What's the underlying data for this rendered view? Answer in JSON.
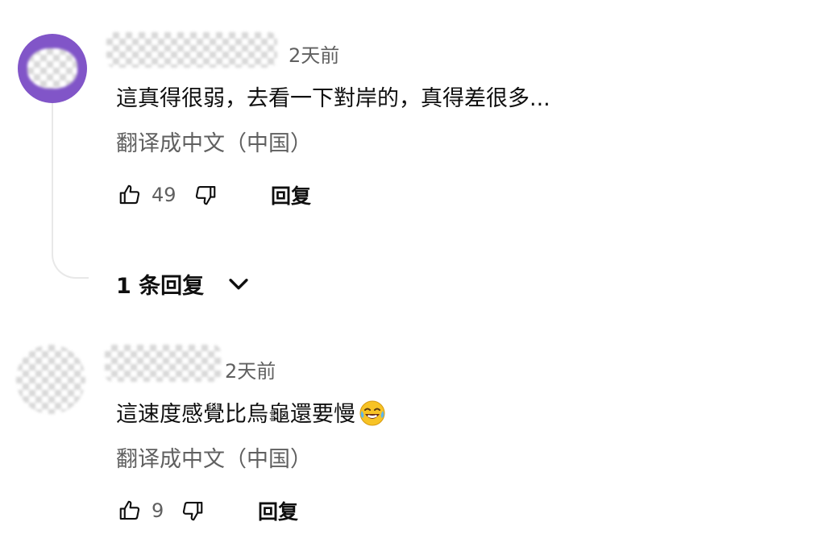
{
  "comments": [
    {
      "time": "2天前",
      "text": "這真得很弱，去看一下對岸的，真得差很多...",
      "translate": "翻译成中文（中国）",
      "likes": "49",
      "reply": "回复",
      "replies_toggle": "1 条回复",
      "avatar_color": "#8155c8"
    },
    {
      "time": "2天前",
      "text": "這速度感覺比烏龜還要慢",
      "emoji": "face-with-tears-of-joy",
      "translate": "翻译成中文（中国）",
      "likes": "9",
      "reply": "回复"
    }
  ],
  "icons": {
    "like": "thumbs-up-icon",
    "dislike": "thumbs-down-icon",
    "expand": "chevron-down-icon"
  },
  "colors": {
    "text": "#0f0f0f",
    "secondary": "#606060",
    "thread_line": "#e8e8e8"
  }
}
